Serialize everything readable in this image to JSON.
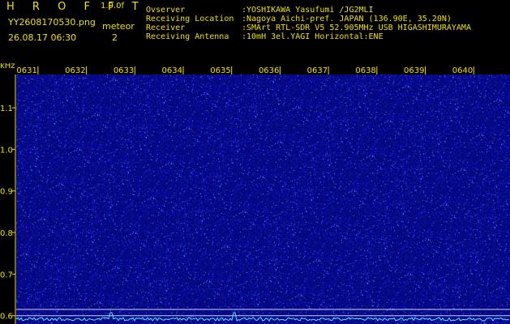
{
  "header": {
    "app_title": "H R O F F T",
    "app_version": "1.0.0f",
    "file_name": "YY2608170530.png",
    "timestamp": "26.08.17 06:30",
    "mode_label": "meteor",
    "meteor_count": "2",
    "info": [
      {
        "key": "Ovserver",
        "value": ":YOSHIKAWA Yasufumi /JG2MLI"
      },
      {
        "key": "Receiving Location",
        "value": ":Nagoya Aichi-pref. JAPAN (136.90E, 35.20N)"
      },
      {
        "key": "Receiver",
        "value": ":SMArt RTL-SDR V5 52.905MHz USB HIGASHIMURAYAMA"
      },
      {
        "key": "Receiving Antenna",
        "value": ":10mH 3el.YAGI Horizontal:ENE"
      }
    ]
  },
  "colors": {
    "text": "#f0e000",
    "background": "#000000",
    "noise_base": "#0a0e8c",
    "noise_bright": "#4f8bff",
    "signal": "#29d4f5",
    "trace": "#52e8ff"
  },
  "chart_data": {
    "type": "heatmap",
    "ylabel": "kHz",
    "y_ticks": [
      "1.1",
      "1.0",
      "0.9",
      "0.8",
      "0.7",
      "0.6"
    ],
    "y_tick_values": [
      1.1,
      1.0,
      0.9,
      0.8,
      0.7,
      0.6
    ],
    "ylim": [
      0.58,
      1.18
    ],
    "x_ticks": [
      "0631",
      "0632",
      "0633",
      "0634",
      "0635",
      "0636",
      "0637",
      "0638",
      "0639",
      "0640"
    ],
    "x_tick_minutes": [
      31,
      32,
      33,
      34,
      35,
      36,
      37,
      38,
      39,
      40
    ],
    "xlim": [
      30.55,
      40.75
    ],
    "carrier_lines_khz": [
      0.615,
      0.6
    ]
  }
}
